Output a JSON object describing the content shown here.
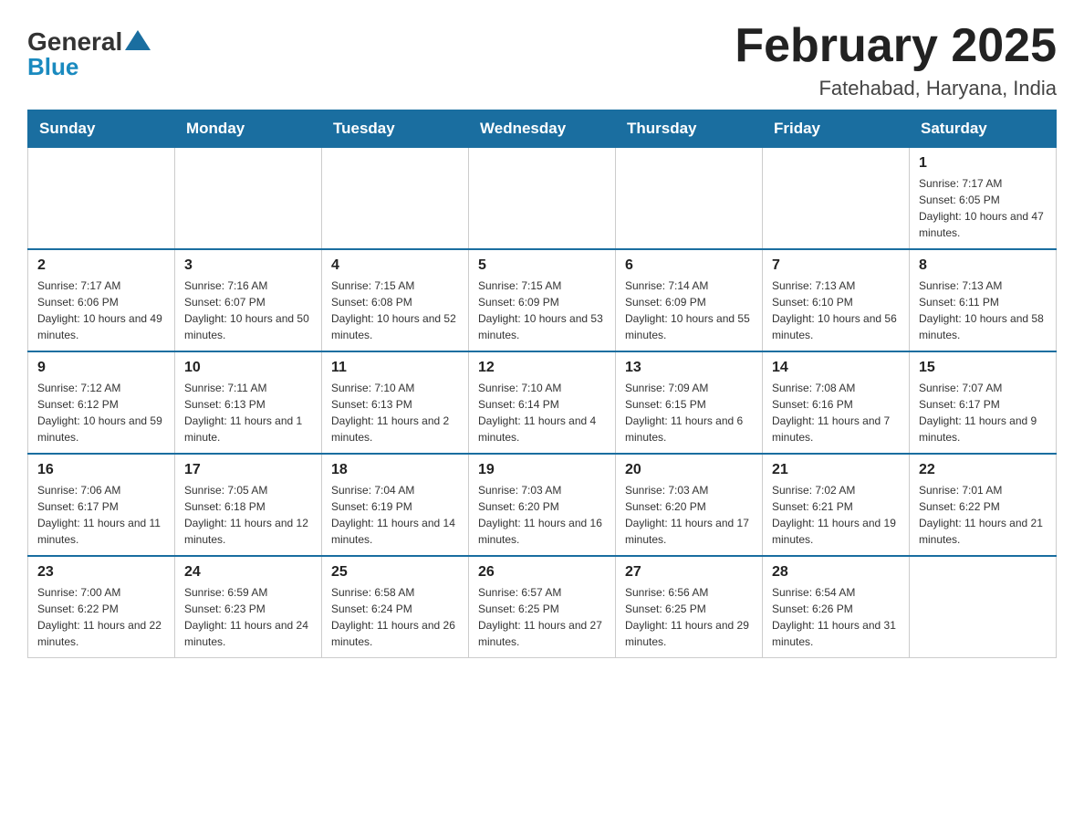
{
  "header": {
    "logo": {
      "general": "General",
      "blue": "Blue"
    },
    "title": "February 2025",
    "subtitle": "Fatehabad, Haryana, India"
  },
  "days_of_week": [
    "Sunday",
    "Monday",
    "Tuesday",
    "Wednesday",
    "Thursday",
    "Friday",
    "Saturday"
  ],
  "weeks": [
    [
      {
        "day": "",
        "sunrise": "",
        "sunset": "",
        "daylight": ""
      },
      {
        "day": "",
        "sunrise": "",
        "sunset": "",
        "daylight": ""
      },
      {
        "day": "",
        "sunrise": "",
        "sunset": "",
        "daylight": ""
      },
      {
        "day": "",
        "sunrise": "",
        "sunset": "",
        "daylight": ""
      },
      {
        "day": "",
        "sunrise": "",
        "sunset": "",
        "daylight": ""
      },
      {
        "day": "",
        "sunrise": "",
        "sunset": "",
        "daylight": ""
      },
      {
        "day": "1",
        "sunrise": "Sunrise: 7:17 AM",
        "sunset": "Sunset: 6:05 PM",
        "daylight": "Daylight: 10 hours and 47 minutes."
      }
    ],
    [
      {
        "day": "2",
        "sunrise": "Sunrise: 7:17 AM",
        "sunset": "Sunset: 6:06 PM",
        "daylight": "Daylight: 10 hours and 49 minutes."
      },
      {
        "day": "3",
        "sunrise": "Sunrise: 7:16 AM",
        "sunset": "Sunset: 6:07 PM",
        "daylight": "Daylight: 10 hours and 50 minutes."
      },
      {
        "day": "4",
        "sunrise": "Sunrise: 7:15 AM",
        "sunset": "Sunset: 6:08 PM",
        "daylight": "Daylight: 10 hours and 52 minutes."
      },
      {
        "day": "5",
        "sunrise": "Sunrise: 7:15 AM",
        "sunset": "Sunset: 6:09 PM",
        "daylight": "Daylight: 10 hours and 53 minutes."
      },
      {
        "day": "6",
        "sunrise": "Sunrise: 7:14 AM",
        "sunset": "Sunset: 6:09 PM",
        "daylight": "Daylight: 10 hours and 55 minutes."
      },
      {
        "day": "7",
        "sunrise": "Sunrise: 7:13 AM",
        "sunset": "Sunset: 6:10 PM",
        "daylight": "Daylight: 10 hours and 56 minutes."
      },
      {
        "day": "8",
        "sunrise": "Sunrise: 7:13 AM",
        "sunset": "Sunset: 6:11 PM",
        "daylight": "Daylight: 10 hours and 58 minutes."
      }
    ],
    [
      {
        "day": "9",
        "sunrise": "Sunrise: 7:12 AM",
        "sunset": "Sunset: 6:12 PM",
        "daylight": "Daylight: 10 hours and 59 minutes."
      },
      {
        "day": "10",
        "sunrise": "Sunrise: 7:11 AM",
        "sunset": "Sunset: 6:13 PM",
        "daylight": "Daylight: 11 hours and 1 minute."
      },
      {
        "day": "11",
        "sunrise": "Sunrise: 7:10 AM",
        "sunset": "Sunset: 6:13 PM",
        "daylight": "Daylight: 11 hours and 2 minutes."
      },
      {
        "day": "12",
        "sunrise": "Sunrise: 7:10 AM",
        "sunset": "Sunset: 6:14 PM",
        "daylight": "Daylight: 11 hours and 4 minutes."
      },
      {
        "day": "13",
        "sunrise": "Sunrise: 7:09 AM",
        "sunset": "Sunset: 6:15 PM",
        "daylight": "Daylight: 11 hours and 6 minutes."
      },
      {
        "day": "14",
        "sunrise": "Sunrise: 7:08 AM",
        "sunset": "Sunset: 6:16 PM",
        "daylight": "Daylight: 11 hours and 7 minutes."
      },
      {
        "day": "15",
        "sunrise": "Sunrise: 7:07 AM",
        "sunset": "Sunset: 6:17 PM",
        "daylight": "Daylight: 11 hours and 9 minutes."
      }
    ],
    [
      {
        "day": "16",
        "sunrise": "Sunrise: 7:06 AM",
        "sunset": "Sunset: 6:17 PM",
        "daylight": "Daylight: 11 hours and 11 minutes."
      },
      {
        "day": "17",
        "sunrise": "Sunrise: 7:05 AM",
        "sunset": "Sunset: 6:18 PM",
        "daylight": "Daylight: 11 hours and 12 minutes."
      },
      {
        "day": "18",
        "sunrise": "Sunrise: 7:04 AM",
        "sunset": "Sunset: 6:19 PM",
        "daylight": "Daylight: 11 hours and 14 minutes."
      },
      {
        "day": "19",
        "sunrise": "Sunrise: 7:03 AM",
        "sunset": "Sunset: 6:20 PM",
        "daylight": "Daylight: 11 hours and 16 minutes."
      },
      {
        "day": "20",
        "sunrise": "Sunrise: 7:03 AM",
        "sunset": "Sunset: 6:20 PM",
        "daylight": "Daylight: 11 hours and 17 minutes."
      },
      {
        "day": "21",
        "sunrise": "Sunrise: 7:02 AM",
        "sunset": "Sunset: 6:21 PM",
        "daylight": "Daylight: 11 hours and 19 minutes."
      },
      {
        "day": "22",
        "sunrise": "Sunrise: 7:01 AM",
        "sunset": "Sunset: 6:22 PM",
        "daylight": "Daylight: 11 hours and 21 minutes."
      }
    ],
    [
      {
        "day": "23",
        "sunrise": "Sunrise: 7:00 AM",
        "sunset": "Sunset: 6:22 PM",
        "daylight": "Daylight: 11 hours and 22 minutes."
      },
      {
        "day": "24",
        "sunrise": "Sunrise: 6:59 AM",
        "sunset": "Sunset: 6:23 PM",
        "daylight": "Daylight: 11 hours and 24 minutes."
      },
      {
        "day": "25",
        "sunrise": "Sunrise: 6:58 AM",
        "sunset": "Sunset: 6:24 PM",
        "daylight": "Daylight: 11 hours and 26 minutes."
      },
      {
        "day": "26",
        "sunrise": "Sunrise: 6:57 AM",
        "sunset": "Sunset: 6:25 PM",
        "daylight": "Daylight: 11 hours and 27 minutes."
      },
      {
        "day": "27",
        "sunrise": "Sunrise: 6:56 AM",
        "sunset": "Sunset: 6:25 PM",
        "daylight": "Daylight: 11 hours and 29 minutes."
      },
      {
        "day": "28",
        "sunrise": "Sunrise: 6:54 AM",
        "sunset": "Sunset: 6:26 PM",
        "daylight": "Daylight: 11 hours and 31 minutes."
      },
      {
        "day": "",
        "sunrise": "",
        "sunset": "",
        "daylight": ""
      }
    ]
  ]
}
